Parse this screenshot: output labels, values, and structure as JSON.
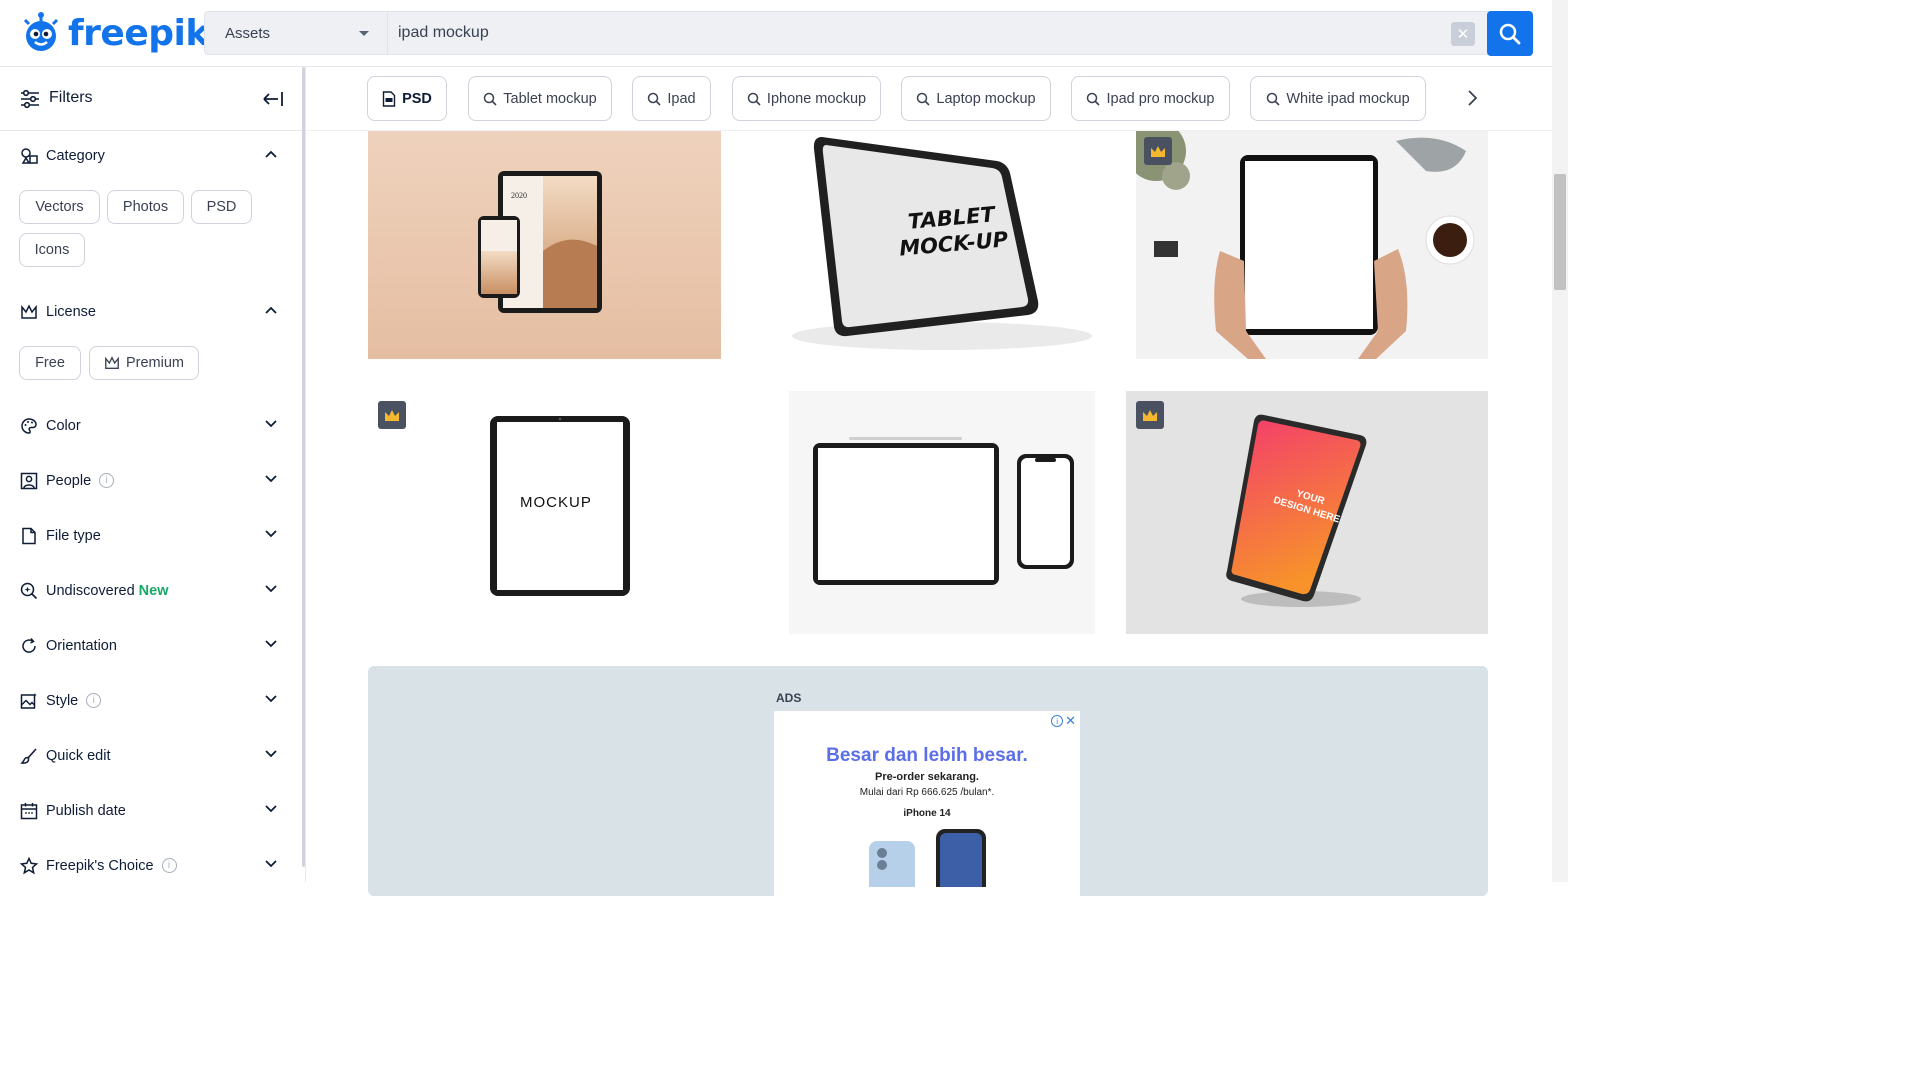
{
  "header": {
    "logo_text": "freepik",
    "asset_select": "Assets",
    "search_value": "ipad mockup",
    "clear_icon": "close-icon",
    "search_icon": "search-icon"
  },
  "sidebar": {
    "title": "Filters",
    "category": {
      "label": "Category",
      "chips": [
        "Vectors",
        "Photos",
        "PSD",
        "Icons"
      ]
    },
    "license": {
      "label": "License",
      "chips": [
        "Free",
        "Premium"
      ]
    },
    "sections": [
      {
        "label": "Color"
      },
      {
        "label": "People"
      },
      {
        "label": "File type"
      },
      {
        "label": "Undiscovered",
        "badge": "New"
      },
      {
        "label": "Orientation"
      },
      {
        "label": "Style"
      },
      {
        "label": "Quick edit"
      },
      {
        "label": "Publish date"
      },
      {
        "label": "Freepik's Choice"
      }
    ]
  },
  "tags": [
    "PSD",
    "Tablet mockup",
    "Ipad",
    "Iphone mockup",
    "Laptop mockup",
    "Ipad pro mockup",
    "White ipad mockup"
  ],
  "grid": {
    "card1_text": "2020",
    "card2_text_line1": "TABLET",
    "card2_text_line2": "MOCK-UP",
    "card4_text": "MOCKUP",
    "card6_text_line1": "YOUR",
    "card6_text_line2": "DESIGN HERE"
  },
  "ad": {
    "label": "ADS",
    "headline": "Besar dan lebih besar.",
    "line1": "Pre-order sekarang.",
    "line2": "Mulai dari Rp 666.625 /bulan*.",
    "line3": "iPhone 14"
  },
  "colors": {
    "brand": "#1273eb",
    "new_badge": "#18a968",
    "crown": "#f5b82e"
  }
}
